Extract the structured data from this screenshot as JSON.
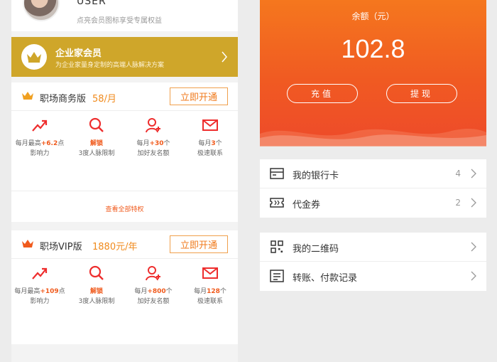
{
  "profile": {
    "username": "USER",
    "description": "点亮会员图标享受专属权益"
  },
  "enterprise": {
    "title": "企业家会员",
    "description": "为企业家量身定制的高端人脉解决方案"
  },
  "plans": [
    {
      "title": "职场商务版",
      "price": "58/月",
      "button": "立即开通",
      "benefits": [
        {
          "icon": "trend-up-icon",
          "pre": "每月最高",
          "hl": "+6.2",
          "post": "点",
          "line2": "影响力"
        },
        {
          "icon": "search-icon",
          "pre": "",
          "hl": "解锁",
          "post": "",
          "line2": "3度人脉限制"
        },
        {
          "icon": "add-user-icon",
          "pre": "每月",
          "hl": "+30",
          "post": "个",
          "line2": "加好友名额"
        },
        {
          "icon": "mail-icon",
          "pre": "每月",
          "hl": "3",
          "post": "个",
          "line2": "极速联系"
        }
      ],
      "view_all": "查看全部特权"
    },
    {
      "title": "职场VIP版",
      "price": "1880元/年",
      "button": "立即开通",
      "benefits": [
        {
          "icon": "trend-up-icon",
          "pre": "每月最高",
          "hl": "+109",
          "post": "点",
          "line2": "影响力"
        },
        {
          "icon": "search-icon",
          "pre": "",
          "hl": "解锁",
          "post": "",
          "line2": "3度人脉限制"
        },
        {
          "icon": "add-user-icon",
          "pre": "每月",
          "hl": "+800",
          "post": "个",
          "line2": "加好友名额"
        },
        {
          "icon": "mail-icon",
          "pre": "每月",
          "hl": "128",
          "post": "个",
          "line2": "极速联系"
        }
      ]
    }
  ],
  "wallet": {
    "balance_label": "余额（元）",
    "balance_value": "102.8",
    "recharge": "充值",
    "withdraw": "提现",
    "menu": [
      {
        "icon": "bank-card-icon",
        "label": "我的银行卡",
        "count": "4"
      },
      {
        "icon": "voucher-icon",
        "label": "代金券",
        "count": "2"
      },
      {
        "icon": "qr-code-icon",
        "label": "我的二维码",
        "count": ""
      },
      {
        "icon": "record-list-icon",
        "label": "转账、付款记录",
        "count": ""
      }
    ]
  },
  "colors": {
    "accent": "#f05a1c",
    "gold": "#cfa62a",
    "orange_gradient_top": "#f5771e",
    "orange_gradient_bottom": "#ee4a2a"
  }
}
